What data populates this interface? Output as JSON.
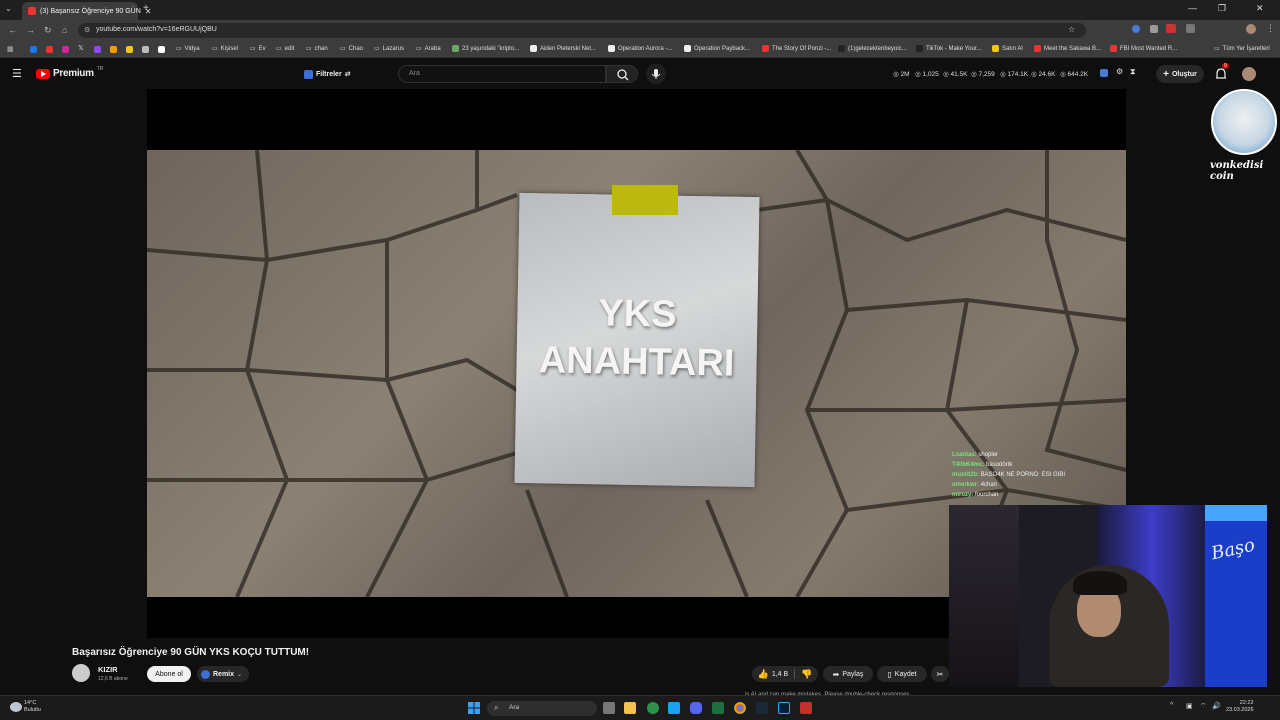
{
  "browser": {
    "tab_title": "(3) Başarısız Öğrenciye 90 GÜN",
    "url": "youtube.com/watch?v=16eRGUUjQBU",
    "bookmarks": [
      "Vidya",
      "Kişisel",
      "Ev",
      "edit",
      "chan",
      "Chao",
      "Lazarus",
      "Araba",
      "23 yaşındaki \"kripto...",
      "Aiden Pleterski Net...",
      "Operation Aurora -...",
      "Operation Payback...",
      "The Story Of Ponzi -...",
      "(1)gelecektenbeyoic...",
      "TikTok - Make Your...",
      "Satın Al",
      "Meet the Sakawa B...",
      "FBI Most Wanted R...",
      "Tüm Yer İşaretleri"
    ]
  },
  "youtube": {
    "brand": "Premium",
    "brand_sup": "TR",
    "filter_label": "Filtreler",
    "search_placeholder": "Ara",
    "stats": [
      "2M",
      "1,025",
      "41.5K",
      "7,259",
      "174.1K",
      "24.6K",
      "644.2K"
    ],
    "create_label": "Oluştur",
    "notif_count": "9"
  },
  "video": {
    "poster_line1": "YKS",
    "poster_line2": "ANAHTARI",
    "chat": [
      {
        "user": "Lsantas:",
        "msg": "shopler"
      },
      {
        "user": "T4llbK4mc:",
        "msg": "basodörtk"
      },
      {
        "user": "mustit2b:",
        "msg": "BASO4K NE PORNO  ESI GIBI"
      },
      {
        "user": "omerkwr:",
        "msg": "4chan"
      },
      {
        "user": "mirozy:",
        "msg": "fourchan"
      }
    ]
  },
  "meta": {
    "title": "Başarısız Öğrenciye 90 GÜN YKS KOÇU TUTTUM!",
    "channel": "KIZIR",
    "subscribers": "12,6 B abone",
    "subscribe_label": "Abone ol",
    "remix_label": "Remix",
    "likes": "1,4 B",
    "share_label": "Paylaş",
    "save_label": "Kaydet"
  },
  "overlay": {
    "cat_name": "vonkedisi coin",
    "cam_logo": "Başo",
    "gemini_note": "...is AI and can make mistakes. Please double-check responses."
  },
  "taskbar": {
    "weather_temp": "14°C",
    "weather_desc": "Bulutlu",
    "search_label": "Ara",
    "time": "22:22",
    "date": "23.03.2026"
  }
}
